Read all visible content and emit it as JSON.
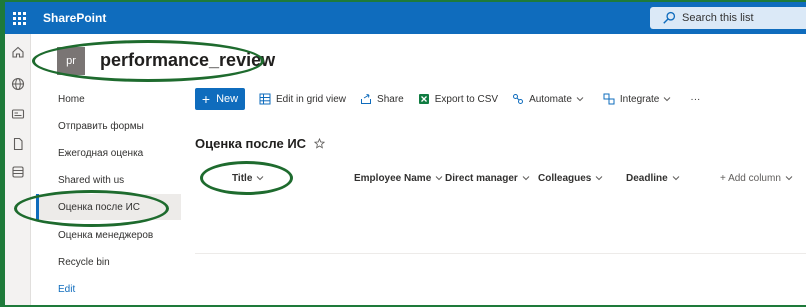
{
  "suitebar": {
    "app_name": "SharePoint",
    "search_placeholder": "Search this list",
    "brand_color": "#0f6cbd"
  },
  "appbar": {
    "icons": [
      "home-icon",
      "globe-icon",
      "news-icon",
      "document-icon",
      "list-icon"
    ]
  },
  "site": {
    "logo_text": "pr",
    "title": "performance_review"
  },
  "leftnav": {
    "items": [
      {
        "label": "Home",
        "selected": false
      },
      {
        "label": "Отправить формы",
        "selected": false
      },
      {
        "label": "Ежегодная оценка",
        "selected": false
      },
      {
        "label": "Shared with us",
        "selected": false
      },
      {
        "label": "Оценка после ИС",
        "selected": true
      },
      {
        "label": "Оценка менеджеров",
        "selected": false
      },
      {
        "label": "Recycle bin",
        "selected": false
      }
    ],
    "edit_label": "Edit"
  },
  "commandbar": {
    "new_label": "New",
    "edit_grid_label": "Edit in grid view",
    "share_label": "Share",
    "export_label": "Export to CSV",
    "automate_label": "Automate",
    "integrate_label": "Integrate",
    "more_label": "···"
  },
  "list": {
    "title": "Оценка после ИС",
    "columns": [
      "Title",
      "Employee Name",
      "Direct manager",
      "Colleagues",
      "Deadline"
    ],
    "add_column_label": "+ Add column"
  },
  "annotation_color": "#1e6b2e"
}
